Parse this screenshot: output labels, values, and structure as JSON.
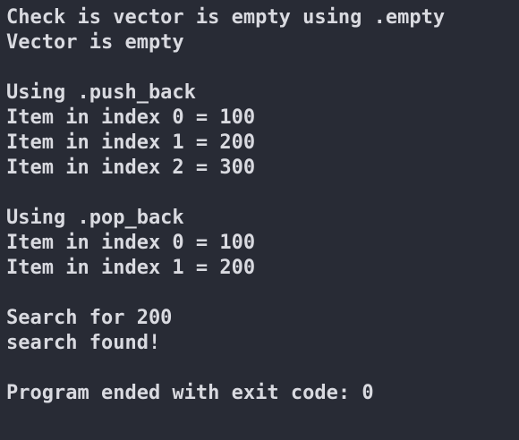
{
  "console": {
    "lines": [
      "Check is vector is empty using .empty",
      "Vector is empty",
      "",
      "Using .push_back",
      "Item in index 0 = 100",
      "Item in index 1 = 200",
      "Item in index 2 = 300",
      "",
      "Using .pop_back",
      "Item in index 0 = 100",
      "Item in index 1 = 200",
      "",
      "Search for 200",
      "search found!",
      "",
      "Program ended with exit code: 0"
    ]
  },
  "colors": {
    "background": "#282b35",
    "text": "#d9dae0"
  }
}
